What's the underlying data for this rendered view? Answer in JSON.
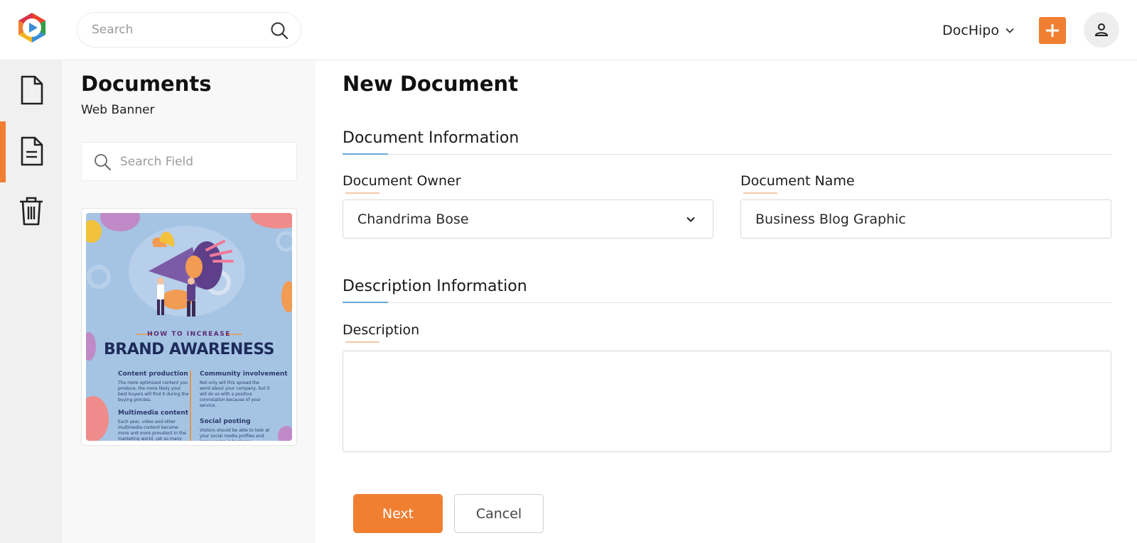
{
  "colors": {
    "accent": "#f07f32",
    "section_underline": "#6aa9d8",
    "rail_bg": "#f0f0f0",
    "panel_bg": "#f8f8f8"
  },
  "header": {
    "logo_icon": "dochipo-logo",
    "search": {
      "placeholder": "Search",
      "icon": "search-icon"
    },
    "account_label": "DocHipo",
    "account_icon": "chevron-down-icon",
    "add_icon": "plus-icon",
    "user_icon": "user-icon"
  },
  "rail": {
    "items": [
      {
        "icon": "document-icon",
        "active": false
      },
      {
        "icon": "document-lines-icon",
        "active": true
      },
      {
        "icon": "trash-icon",
        "active": false
      }
    ]
  },
  "panel": {
    "title": "Documents",
    "subtitle": "Web Banner",
    "search_placeholder": "Search Field",
    "thumbnail": {
      "eyebrow": "HOW TO INCREASE",
      "title": "BRAND AWARENESS",
      "blocks": [
        {
          "heading": "Content production",
          "text": "The more optimized content you produce, the more likely your best buyers will find it during the buying process."
        },
        {
          "heading": "Community involvement",
          "text": "Not only will this spread the word about your company, but it will do so with a positive connotation because of your service."
        },
        {
          "heading": "Multimedia content",
          "text": "Each year, video and other multimedia content become more and more prevalent in the marketing world, yet so many businesses fail to utilize it as a"
        },
        {
          "heading": "Social posting",
          "text": "Visitors should be able to look at your social media profiles and know you're in business."
        }
      ]
    }
  },
  "form": {
    "title": "New Document",
    "sections": {
      "document_info": "Document Information",
      "description_info": "Description Information"
    },
    "owner": {
      "label": "Document Owner",
      "value": "Chandrima Bose"
    },
    "name": {
      "label": "Document Name",
      "value": "Business Blog Graphic"
    },
    "description": {
      "label": "Description",
      "value": ""
    },
    "buttons": {
      "next": "Next",
      "cancel": "Cancel"
    }
  }
}
